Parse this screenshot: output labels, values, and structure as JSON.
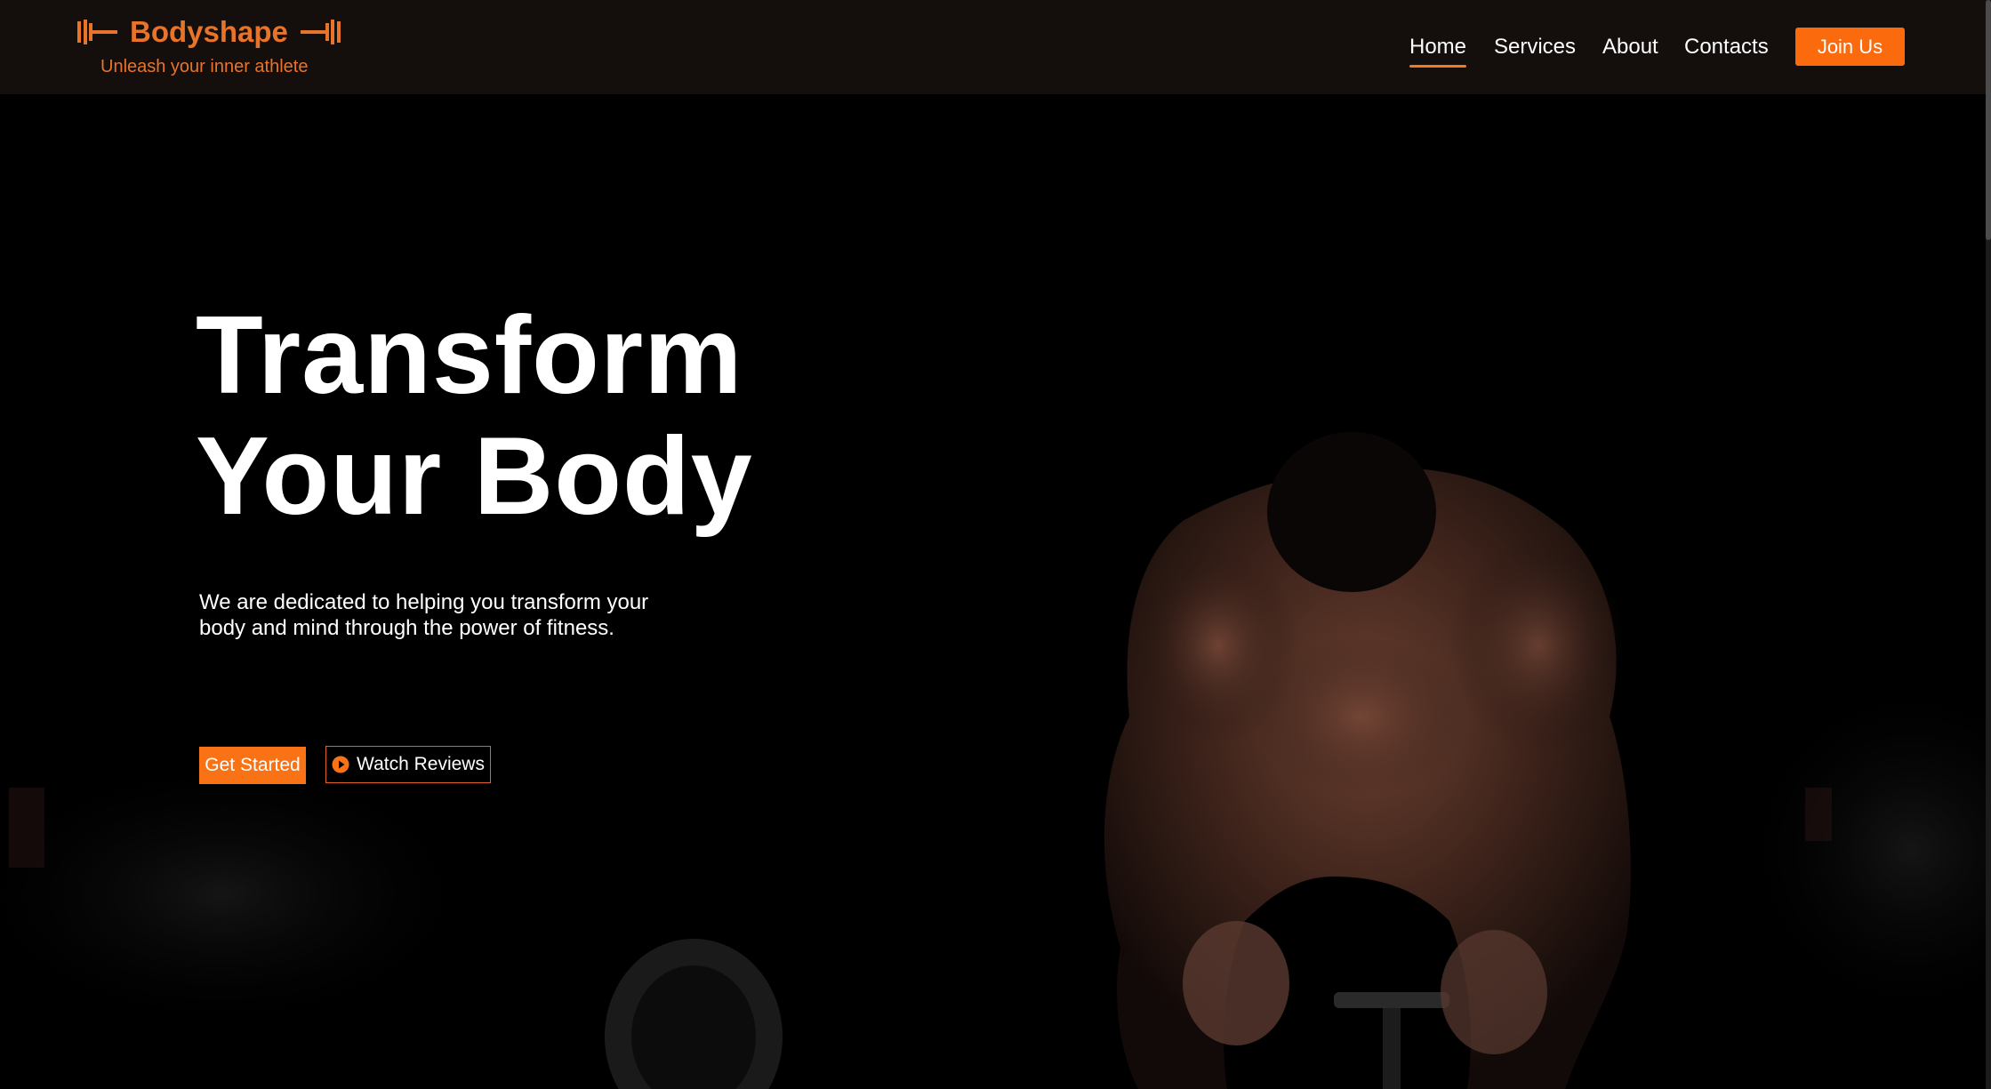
{
  "brand": {
    "name": "Bodyshape",
    "tagline": "Unleash your inner athlete",
    "logo_icon": "dumbbell-icon",
    "color": "#e8742a"
  },
  "nav": {
    "items": [
      {
        "label": "Home",
        "active": true
      },
      {
        "label": "Services",
        "active": false
      },
      {
        "label": "About",
        "active": false
      },
      {
        "label": "Contacts",
        "active": false
      }
    ],
    "cta_label": "Join Us"
  },
  "hero": {
    "title_line1": "Transform",
    "title_line2": "Your Body",
    "description": "We are dedicated to helping you transform your body and mind through the power of fitness.",
    "primary_button": "Get Started",
    "secondary_button": "Watch Reviews",
    "secondary_icon": "play-circle-icon",
    "background_image": "athlete-deadlift-photo"
  },
  "colors": {
    "accent": "#f97316",
    "nav_bg": "#140e0c",
    "hero_bg": "#000000"
  }
}
